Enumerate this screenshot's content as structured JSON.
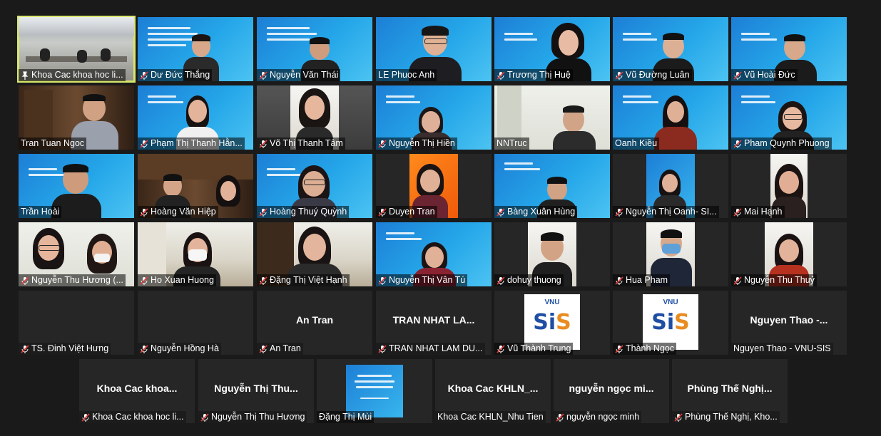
{
  "colors": {
    "active_border": "#d8e66a",
    "muted_icon": "#e23b3b",
    "slide_blue": "#1d7fd6"
  },
  "gallery": {
    "tiles": [
      {
        "name": "Khoa Cac khoa hoc li...",
        "muted": false,
        "pinned": true,
        "active": true
      },
      {
        "name": "Dư Đức Thắng",
        "muted": true
      },
      {
        "name": "Nguyễn Văn Thái",
        "muted": true
      },
      {
        "name": "LE Phuoc Anh",
        "muted": false
      },
      {
        "name": "Trương Thị Huệ",
        "muted": true
      },
      {
        "name": "Vũ Đường Luân",
        "muted": true
      },
      {
        "name": "Vũ Hoài Đức",
        "muted": true
      },
      {
        "name": "Tran Tuan Ngoc",
        "muted": false
      },
      {
        "name": "Phạm Thị Thanh Hằn...",
        "muted": true
      },
      {
        "name": "Võ Thị Thanh Tâm",
        "muted": true
      },
      {
        "name": "Nguyễn Thị Hiền",
        "muted": true
      },
      {
        "name": "NNTruc",
        "muted": false
      },
      {
        "name": "Oanh Kiều",
        "muted": false
      },
      {
        "name": "Pham Quynh Phuong",
        "muted": true
      },
      {
        "name": "Trần Hoài",
        "muted": false
      },
      {
        "name": "Hoàng Văn Hiệp",
        "muted": true
      },
      {
        "name": "Hoàng Thuý Quỳnh",
        "muted": true
      },
      {
        "name": "Duyen Tran",
        "muted": true
      },
      {
        "name": "Bàng Xuân Hùng",
        "muted": true
      },
      {
        "name": "Nguyễn Thị Oanh- SI...",
        "muted": true
      },
      {
        "name": "Mai Hạnh",
        "muted": true
      },
      {
        "name": "Nguyễn Thu Hương (...",
        "muted": true
      },
      {
        "name": "Ho Xuan Huong",
        "muted": true
      },
      {
        "name": "Đặng Thị Việt Hạnh",
        "muted": true
      },
      {
        "name": "Nguyễn Thị Vân Tú",
        "muted": true
      },
      {
        "name": "dohuy thuong",
        "muted": true
      },
      {
        "name": "Hua Pham",
        "muted": true
      },
      {
        "name": "Nguyễn Thu Thuỷ",
        "muted": true
      },
      {
        "name": "TS. Đinh Việt Hưng",
        "muted": true
      },
      {
        "name": "Nguyễn Hồng Hà",
        "muted": true
      },
      {
        "name": "An Tran",
        "muted": true,
        "center_name": "An Tran"
      },
      {
        "name": "TRAN NHAT LAM DU...",
        "muted": true,
        "center_name": "TRAN NHAT LA..."
      },
      {
        "name": "Vũ Thành Trung",
        "muted": true
      },
      {
        "name": "Thành Ngọc",
        "muted": true
      },
      {
        "name": "Nguyen Thao - VNU-SIS",
        "muted": false,
        "center_name": "Nguyen Thao -..."
      },
      {
        "name": "Khoa Cac khoa hoc li...",
        "muted": true,
        "center_name": "Khoa Cac khoa..."
      },
      {
        "name": "Nguyễn Thị Thu Hương",
        "muted": true,
        "center_name": "Nguyễn Thị Thu..."
      },
      {
        "name": "Đặng Thị Mùi",
        "muted": false
      },
      {
        "name": "Khoa Cac KHLN_Nhu Tien",
        "muted": false,
        "center_name": "Khoa Cac KHLN_..."
      },
      {
        "name": "nguyễn ngọc minh",
        "muted": true,
        "center_name": "nguyễn ngọc mi..."
      },
      {
        "name": "Phùng Thế Nghị, Kho...",
        "muted": true,
        "center_name": "Phùng Thế Nghị..."
      }
    ]
  },
  "logo": {
    "part1": "Si",
    "part2": "S",
    "top": "VNU"
  }
}
